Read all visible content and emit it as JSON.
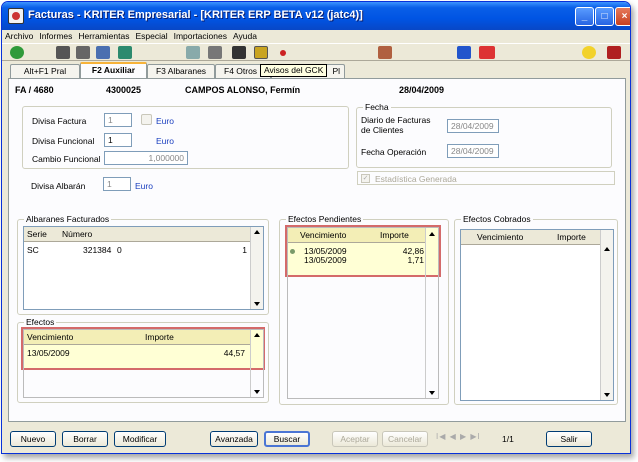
{
  "window": {
    "title": "Facturas - KRITER Empresarial - [KRITER ERP BETA v12 (jatc4)]",
    "minimize": "_",
    "maximize": "□",
    "close": "×"
  },
  "menu": [
    "Archivo",
    "Informes",
    "Herramientas",
    "Especial",
    "Importaciones",
    "Ayuda"
  ],
  "toolbar": {
    "tooltip": "Avisos del GCK"
  },
  "tabs": [
    "Alt+F1 Pral",
    "F2 Auxiliar",
    "F3 Albaranes",
    "F4 Otros",
    "Pl"
  ],
  "header": {
    "invoice": "FA / 4680",
    "code": "4300025",
    "customer": "CAMPOS ALONSO, Fermín",
    "date": "28/04/2009"
  },
  "divisa": {
    "factura_label": "Divisa Factura",
    "factura_value": "1",
    "factura_currency": "Euro",
    "funcional_label": "Divisa Funcional",
    "funcional_value": "1",
    "funcional_currency": "Euro",
    "cambio_label": "Cambio Funcional",
    "cambio_value": "1,000000",
    "albaran_label": "Divisa Albarán",
    "albaran_value": "1",
    "albaran_currency": "Euro"
  },
  "fecha": {
    "group_label": "Fecha",
    "diario_label": "Diario de Facturas de Clientes",
    "diario_value": "28/04/2009",
    "operacion_label": "Fecha Operación",
    "operacion_value": "28/04/2009",
    "estadistica_label": "Estadística Generada"
  },
  "albaranes": {
    "title": "Albaranes Facturados",
    "col_serie": "Serie",
    "col_numero": "Número",
    "rows": [
      {
        "serie": "SC",
        "numero": "321384",
        "a": "0",
        "b": "1"
      }
    ]
  },
  "efectos": {
    "title": "Efectos",
    "col_venc": "Vencimiento",
    "col_importe": "Importe",
    "rows": [
      {
        "venc": "13/05/2009",
        "importe": "44,57"
      }
    ]
  },
  "pendientes": {
    "title": "Efectos Pendientes",
    "col_venc": "Vencimiento",
    "col_importe": "Importe",
    "rows": [
      {
        "venc": "13/05/2009",
        "importe": "42,86"
      },
      {
        "venc": "13/05/2009",
        "importe": "1,71"
      }
    ]
  },
  "cobrados": {
    "title": "Efectos Cobrados",
    "col_venc": "Vencimiento",
    "col_importe": "Importe"
  },
  "footer": {
    "nuevo": "Nuevo",
    "borrar": "Borrar",
    "modificar": "Modificar",
    "avanzada": "Avanzada",
    "buscar": "Buscar",
    "aceptar": "Aceptar",
    "cancelar": "Cancelar",
    "nav": "I◀ ◀ ▶ ▶I",
    "page": "1/1",
    "salir": "Salir"
  }
}
